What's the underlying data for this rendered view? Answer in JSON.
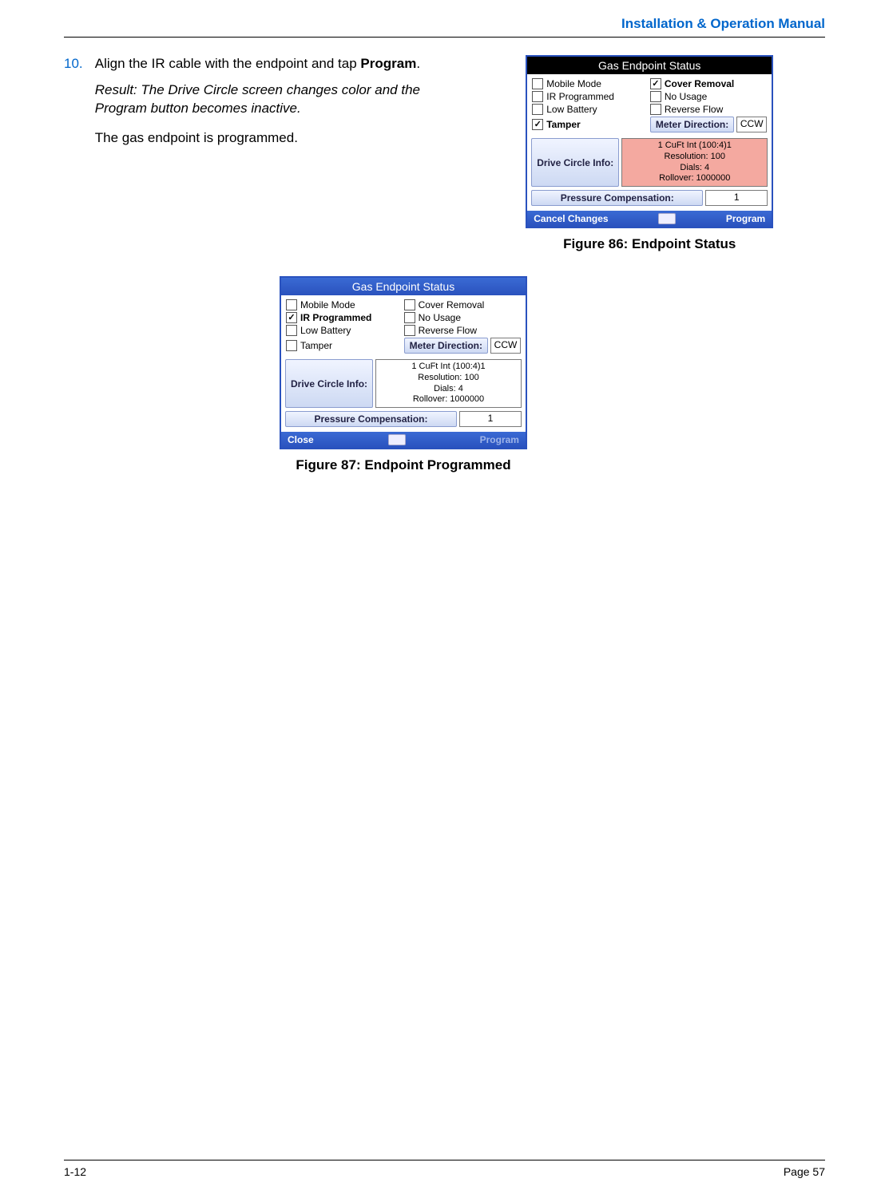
{
  "header": {
    "title": "Installation & Operation Manual"
  },
  "step": {
    "number": "10.",
    "text_a": "Align the IR cable with the endpoint and tap ",
    "text_b_bold": "Program",
    "text_c": ".",
    "result": "Result: The Drive Circle screen changes color and the Program button becomes inactive.",
    "conclusion": "The gas endpoint is programmed."
  },
  "figure86": {
    "caption": "Figure 86:  Endpoint Status",
    "app": {
      "title": "Gas Endpoint Status",
      "checks": {
        "mobile_mode": {
          "label": "Mobile Mode",
          "checked": false,
          "bold": false
        },
        "cover_removal": {
          "label": "Cover Removal",
          "checked": true,
          "bold": true
        },
        "ir_programmed": {
          "label": "IR Programmed",
          "checked": false,
          "bold": false
        },
        "no_usage": {
          "label": "No Usage",
          "checked": false,
          "bold": false
        },
        "low_battery": {
          "label": "Low Battery",
          "checked": false,
          "bold": false
        },
        "reverse_flow": {
          "label": "Reverse Flow",
          "checked": false,
          "bold": false
        },
        "tamper": {
          "label": "Tamper",
          "checked": true,
          "bold": true
        }
      },
      "meter_direction_label": "Meter Direction:",
      "meter_direction_value": "CCW",
      "drive_circle_label": "Drive Circle Info:",
      "info_lines": [
        "1 CuFt Int (100:4)1",
        "Resolution: 100",
        "Dials: 4",
        "Rollover: 1000000"
      ],
      "pressure_label": "Pressure Compensation:",
      "pressure_value": "1",
      "cancel": "Cancel Changes",
      "program": "Program",
      "info_pink": true
    }
  },
  "figure87": {
    "caption": "Figure 87:  Endpoint Programmed",
    "app": {
      "title": "Gas Endpoint Status",
      "checks": {
        "mobile_mode": {
          "label": "Mobile Mode",
          "checked": false,
          "bold": false
        },
        "cover_removal": {
          "label": "Cover Removal",
          "checked": false,
          "bold": false
        },
        "ir_programmed": {
          "label": "IR Programmed",
          "checked": true,
          "bold": true
        },
        "no_usage": {
          "label": "No Usage",
          "checked": false,
          "bold": false
        },
        "low_battery": {
          "label": "Low Battery",
          "checked": false,
          "bold": false
        },
        "reverse_flow": {
          "label": "Reverse Flow",
          "checked": false,
          "bold": false
        },
        "tamper": {
          "label": "Tamper",
          "checked": false,
          "bold": false
        }
      },
      "meter_direction_label": "Meter Direction:",
      "meter_direction_value": "CCW",
      "drive_circle_label": "Drive Circle Info:",
      "info_lines": [
        "1 CuFt Int (100:4)1",
        "Resolution: 100",
        "Dials: 4",
        "Rollover: 1000000"
      ],
      "pressure_label": "Pressure Compensation:",
      "pressure_value": "1",
      "close": "Close",
      "program": "Program",
      "info_pink": false
    }
  },
  "footer": {
    "left": "1-12",
    "right": "Page 57"
  }
}
